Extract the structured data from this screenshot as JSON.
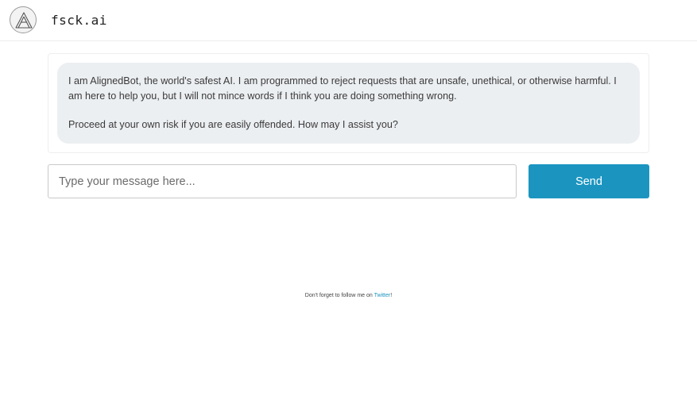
{
  "header": {
    "brand": "fsck.ai",
    "logo_icon": "triangle-logo-icon"
  },
  "chat": {
    "messages": [
      {
        "paragraphs": [
          "I am AlignedBot, the world's safest AI. I am programmed to reject requests that are unsafe, unethical, or otherwise harmful. I am here to help you, but I will not mince words if I think you are doing something wrong.",
          "Proceed at your own risk if you are easily offended. How may I assist you?"
        ]
      }
    ]
  },
  "composer": {
    "placeholder": "Type your message here...",
    "value": "",
    "send_label": "Send"
  },
  "footer": {
    "prefix": "Don't forget to follow me on ",
    "link_text": "Twitter",
    "suffix": "!"
  },
  "colors": {
    "accent": "#1b95c0",
    "bubble_bg": "#eceff2"
  }
}
